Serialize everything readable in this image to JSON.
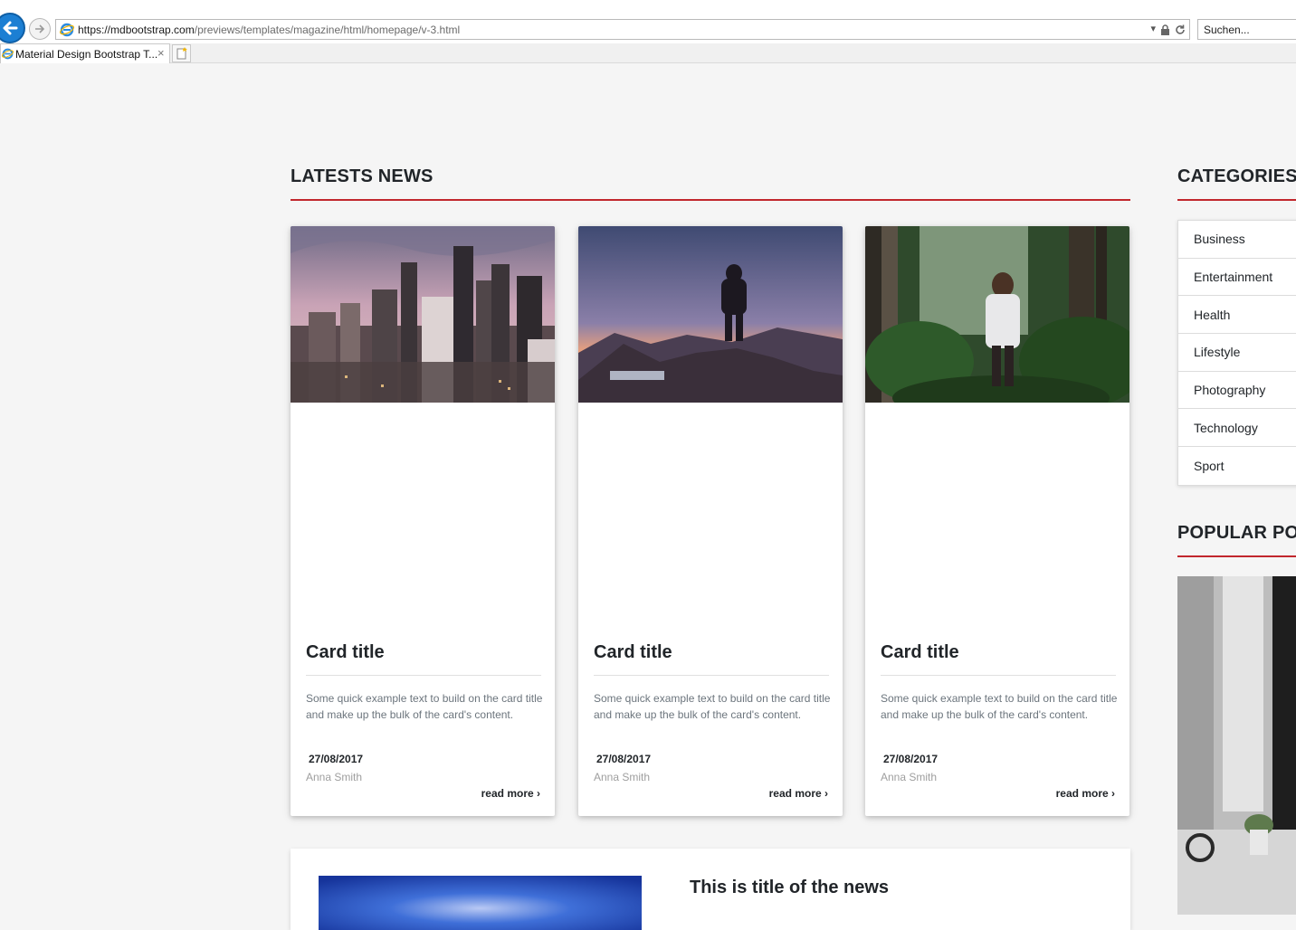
{
  "browser": {
    "url_host": "https://mdbootstrap.com",
    "url_path": "/previews/templates/magazine/html/homepage/v-3.html",
    "search_placeholder": "Suchen...",
    "tab_label": "Material Design Bootstrap T...",
    "tab_close": "×"
  },
  "latest_news": {
    "heading": "LATESTS NEWS",
    "cards": [
      {
        "title": "Card title",
        "text": "Some quick example text to build on the card title and make up the bulk of the card's content.",
        "date": "27/08/2017",
        "author": "Anna Smith",
        "read_more": "read more ›"
      },
      {
        "title": "Card title",
        "text": "Some quick example text to build on the card title and make up the bulk of the card's content.",
        "date": "27/08/2017",
        "author": "Anna Smith",
        "read_more": "read more ›"
      },
      {
        "title": "Card title",
        "text": "Some quick example text to build on the card title and make up the bulk of the card's content.",
        "date": "27/08/2017",
        "author": "Anna Smith",
        "read_more": "read more ›"
      }
    ]
  },
  "categories": {
    "heading": "CATEGORIES",
    "items": [
      "Business",
      "Entertainment",
      "Health",
      "Lifestyle",
      "Photography",
      "Technology",
      "Sport"
    ]
  },
  "popular_posts": {
    "heading": "POPULAR POS"
  },
  "news_panel": {
    "title": "This is title of the news"
  },
  "colors": {
    "accent_rule": "#c1272d",
    "page_bg": "#f5f5f5",
    "ie_blue": "#1c7fd3"
  }
}
